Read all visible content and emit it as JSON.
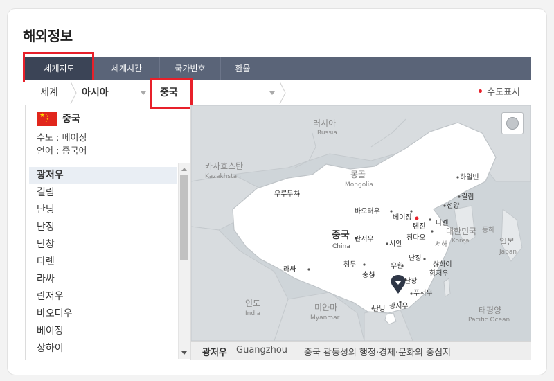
{
  "page_title": "해외정보",
  "tabs": [
    "세계지도",
    "세계시간",
    "국가번호",
    "환율"
  ],
  "breadcrumb": {
    "root": "세계",
    "region": "아시아",
    "country": "중국"
  },
  "capital_legend": "수도표시",
  "country": {
    "name": "중국",
    "capital_line": "수도 : 베이징",
    "language_line": "언어 : 중국어"
  },
  "cities": [
    "광저우",
    "길림",
    "난닝",
    "난징",
    "난창",
    "다롄",
    "라싸",
    "란저우",
    "바오터우",
    "베이징",
    "상하이"
  ],
  "selected_city": "광저우",
  "caption": {
    "city": "광저우",
    "city_en": "Guangzhou",
    "description": "중국 광둥성의 행정·경제·문화의 중심지"
  },
  "map": {
    "country_ko": "중국",
    "country_en": "China",
    "russia_ko": "러시아",
    "russia_en": "Russia",
    "kazakh_ko": "카자흐스탄",
    "kazakh_en": "Kazakhstan",
    "mongolia_ko": "몽골",
    "mongolia_en": "Mongolia",
    "india_ko": "인도",
    "india_en": "India",
    "myanmar_ko": "미얀마",
    "myanmar_en": "Myanmar",
    "korea_ko": "대한민국",
    "korea_en": "Korea",
    "japan_ko": "일본",
    "japan_en": "Japan",
    "pacific_ko": "태평양",
    "pacific_en": "Pacific Ocean",
    "eastsea": "동해",
    "westsea": "서해",
    "c_harbin": "하얼빈",
    "c_jilin": "길림",
    "c_shenyang": "선양",
    "c_dalian": "다롄",
    "c_beijing": "베이징",
    "c_tianjin": "톈진",
    "c_qingdao": "칭다오",
    "c_baotou": "바오터우",
    "c_urumqi": "우루무치",
    "c_lanzhou": "란저우",
    "c_xian": "시안",
    "c_nanjing": "난징",
    "c_shanghai": "상하이",
    "c_hangzhou": "항저우",
    "c_wuhan": "우한",
    "c_chengdu": "청두",
    "c_chongqing": "충칭",
    "c_lhasa": "라싸",
    "c_nanchang": "난창",
    "c_fuzhou": "푸저우",
    "c_nanning": "난닝",
    "c_guangzhou": "광저우"
  },
  "colors": {
    "tab_bar": "#5a6478",
    "tab_active": "#3b4456",
    "highlight": "#e8202a",
    "land": "#ffffff",
    "sea": "#cfd5d9",
    "neighbors": "#d8dcdf"
  }
}
